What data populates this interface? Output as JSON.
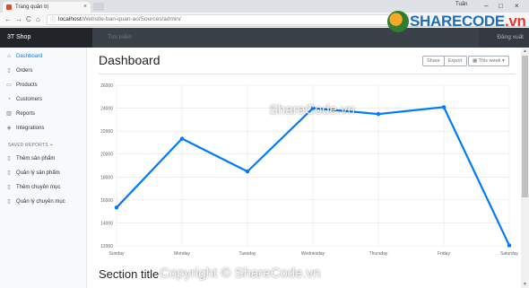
{
  "browser": {
    "tab_title": "Trang quản trị",
    "tab_close": "×",
    "user_name": "Tuấn",
    "window_controls": [
      "–",
      "□",
      "×"
    ],
    "nav": [
      "←",
      "→",
      "C",
      "⌂"
    ],
    "url_host": "localhost",
    "url_path": "/Website-ban-quan-ao/Sources/admin/",
    "star": "☆"
  },
  "navbar": {
    "brand": "3T Shop",
    "search_placeholder": "Tìm kiếm",
    "signout": "Đăng xuất"
  },
  "sidebar": {
    "items": [
      {
        "label": "Dashboard",
        "icon": "home-icon",
        "glyph": "⌂",
        "active": true
      },
      {
        "label": "Orders",
        "icon": "file-icon",
        "glyph": "▯",
        "active": false
      },
      {
        "label": "Products",
        "icon": "cart-icon",
        "glyph": "▭",
        "active": false
      },
      {
        "label": "Customers",
        "icon": "users-icon",
        "glyph": "◔",
        "active": false
      },
      {
        "label": "Reports",
        "icon": "bar-chart-icon",
        "glyph": "▥",
        "active": false
      },
      {
        "label": "Integrations",
        "icon": "layers-icon",
        "glyph": "◈",
        "active": false
      }
    ],
    "saved_heading": "SAVED REPORTS",
    "saved_plus": "+",
    "saved_items": [
      {
        "label": "Thêm sản phẩm",
        "icon": "file-text-icon",
        "glyph": "▯"
      },
      {
        "label": "Quản lý sản phẩm",
        "icon": "file-text-icon",
        "glyph": "▯"
      },
      {
        "label": "Thêm chuyên mục",
        "icon": "file-text-icon",
        "glyph": "▯"
      },
      {
        "label": "Quản lý chuyên mục",
        "icon": "file-text-icon",
        "glyph": "▯"
      }
    ]
  },
  "main": {
    "title": "Dashboard",
    "share": "Share",
    "export": "Export",
    "week": "This week",
    "week_icon": "calendar-icon",
    "section_title": "Section title"
  },
  "chart_data": {
    "type": "line",
    "categories": [
      "Sunday",
      "Monday",
      "Tuesday",
      "Wednesday",
      "Thursday",
      "Friday",
      "Saturday"
    ],
    "values": [
      15339,
      21345,
      18483,
      24003,
      23489,
      24092,
      12034
    ],
    "y_ticks": [
      12000,
      14000,
      16000,
      18000,
      20000,
      22000,
      24000,
      26000
    ],
    "ylim": [
      12000,
      26000
    ],
    "grid": true,
    "line_color": "#007bff",
    "title": "",
    "xlabel": "",
    "ylabel": ""
  },
  "watermark": {
    "logo_text": "SHARECODE",
    "logo_suffix": ".vn",
    "center_text": "ShareCode.vn",
    "footer_text": "Copyright © ShareCode.vn"
  }
}
